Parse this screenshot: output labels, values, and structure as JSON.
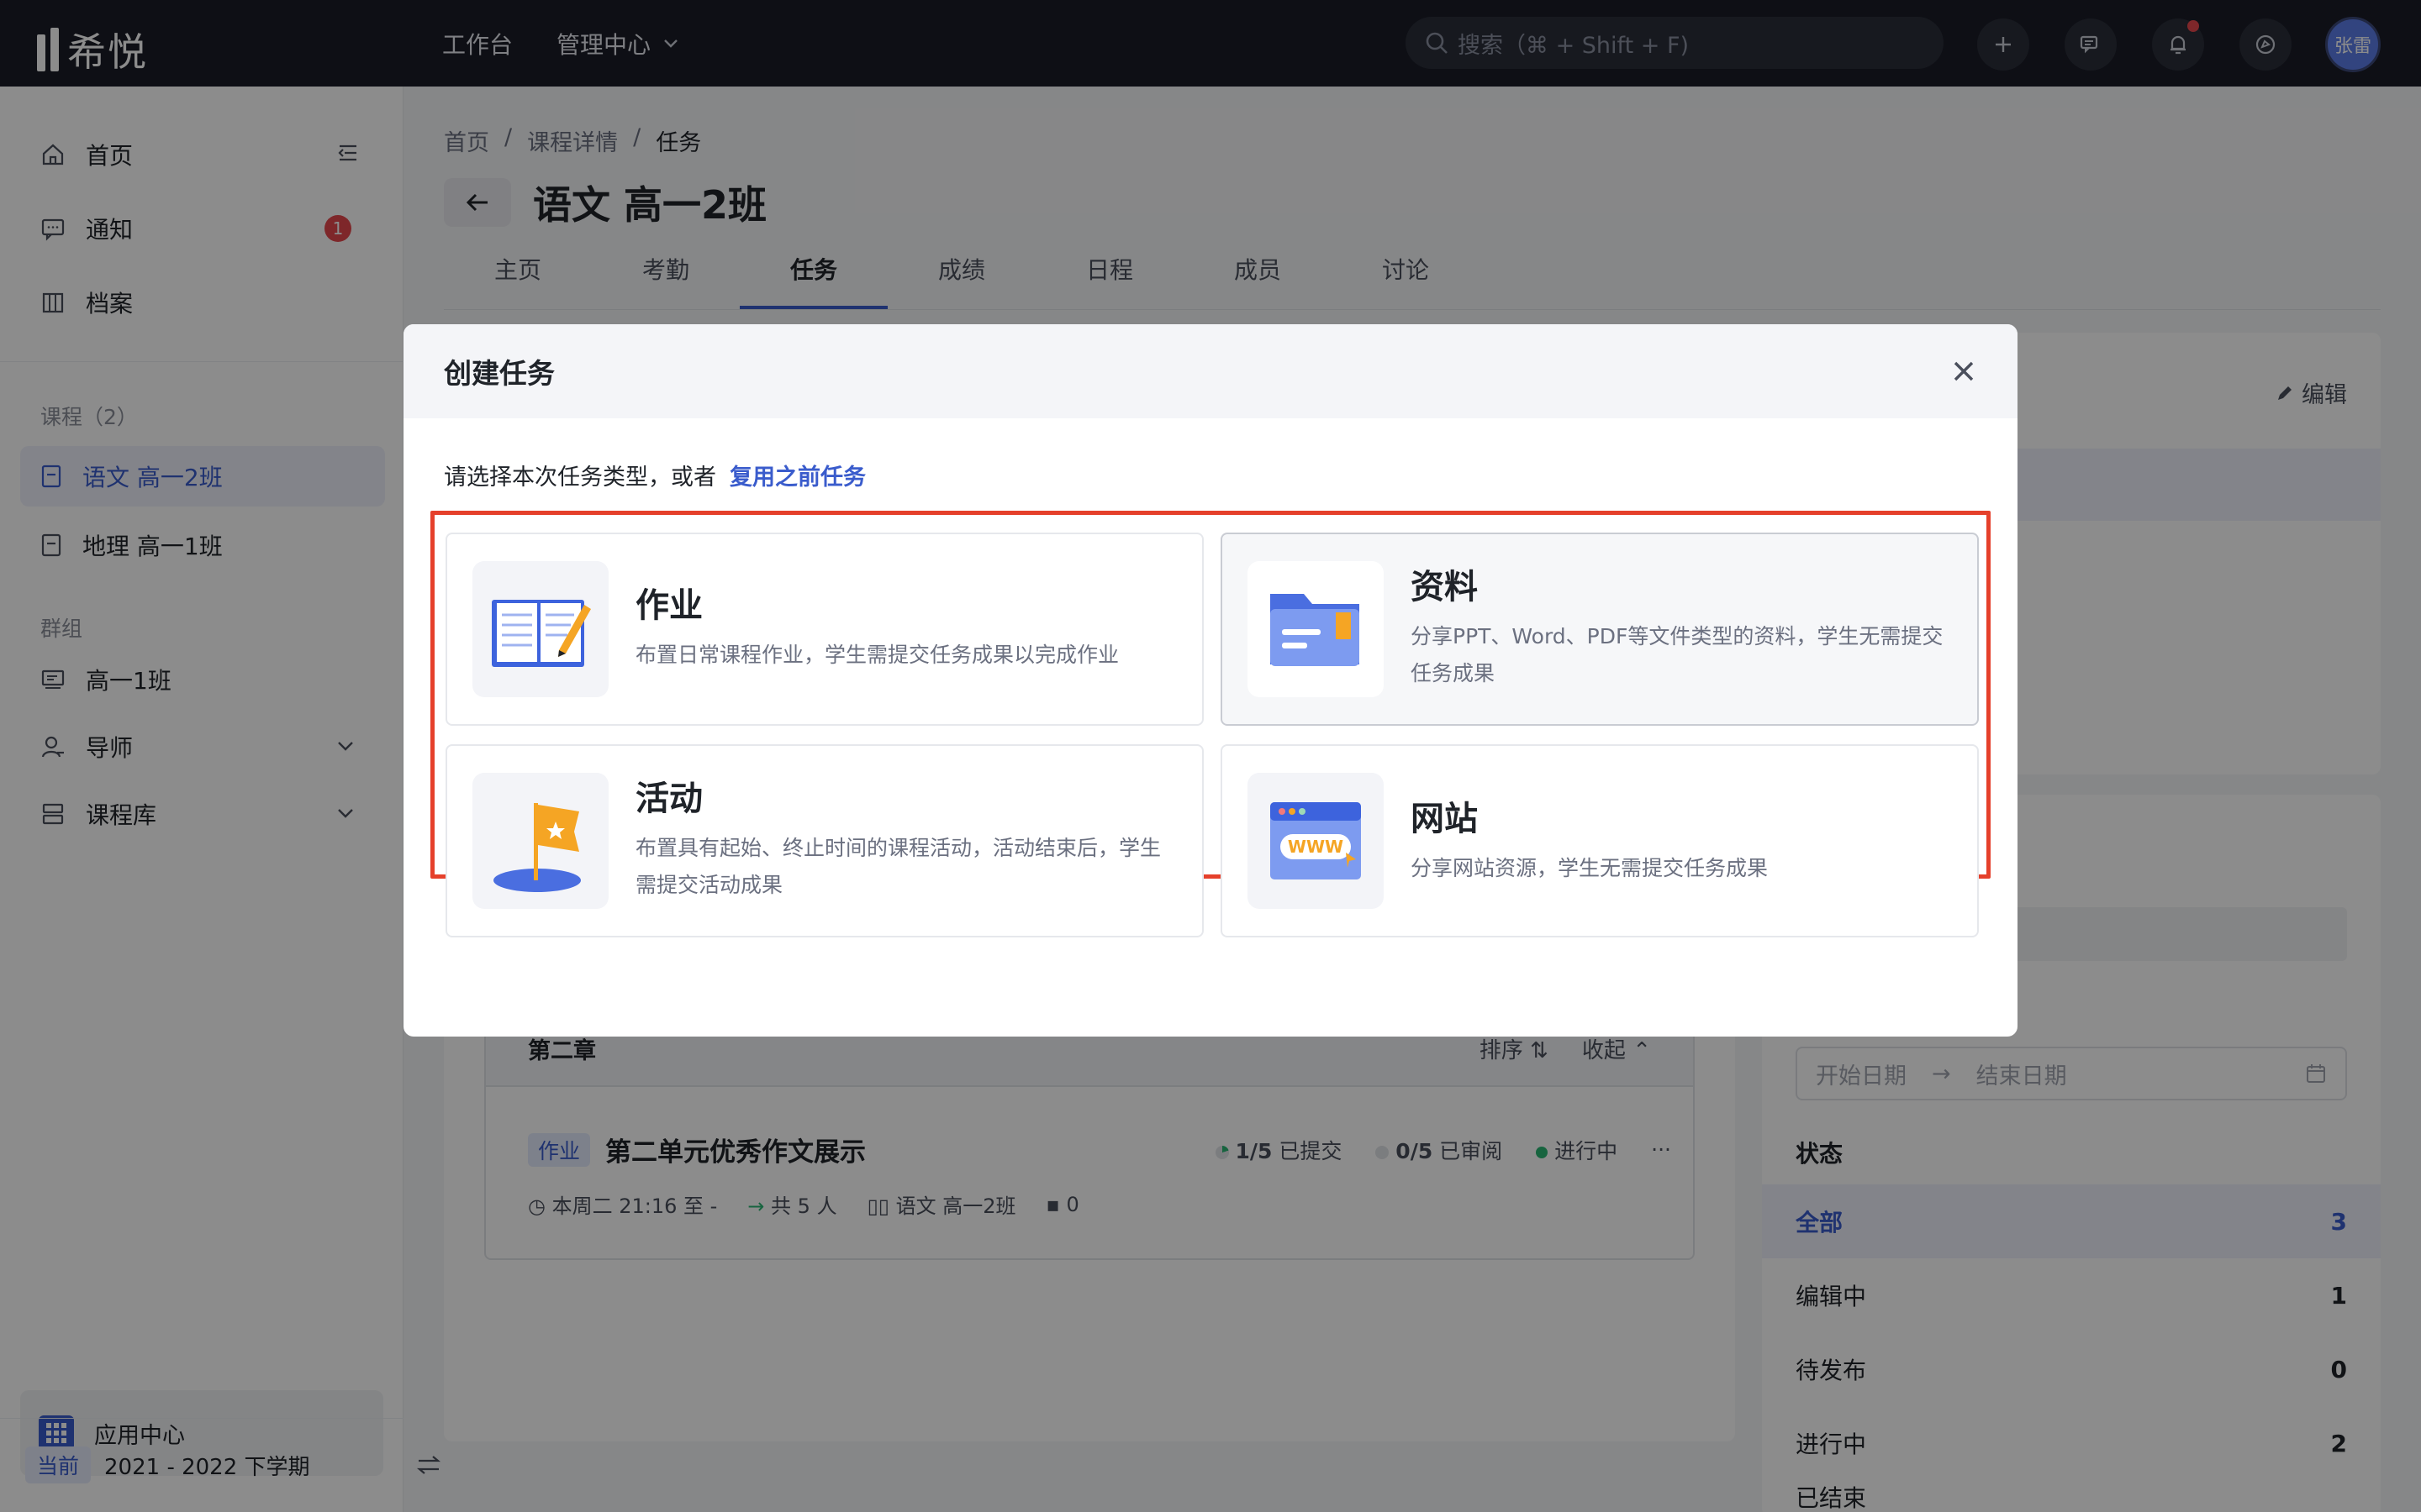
{
  "app": {
    "logo_text": "希悦"
  },
  "topbar": {
    "nav": [
      "工作台",
      "管理中心"
    ],
    "search_placeholder": "搜索（⌘ + Shift + F)",
    "avatar": "张雷"
  },
  "sidebar": {
    "main_items": [
      {
        "label": "首页",
        "icon": "home-icon"
      },
      {
        "label": "通知",
        "icon": "message-icon",
        "badge": "1"
      },
      {
        "label": "档案",
        "icon": "archive-icon"
      }
    ],
    "courses_heading": "课程（2）",
    "courses": [
      "语文 高一2班",
      "地理 高一1班"
    ],
    "groups_heading": "群组",
    "groups": [
      "高一1班",
      "导师",
      "课程库"
    ],
    "app_center": "应用中心",
    "term_label": "当前",
    "term_value": "2021 - 2022 下学期"
  },
  "breadcrumb": [
    "首页",
    "课程详情",
    "任务"
  ],
  "page": {
    "title": "语文 高一2班",
    "tabs": [
      "主页",
      "考勤",
      "任务",
      "成绩",
      "日程",
      "成员",
      "讨论"
    ],
    "active_tab": "任务"
  },
  "task_list": {
    "section": "第二章",
    "sort_label": "排序",
    "collapse_label": "收起",
    "task": {
      "type_tag": "作业",
      "title": "第二单元优秀作文展示",
      "submitted": "1/5",
      "submitted_label": "已提交",
      "reviewed": "0/5",
      "reviewed_label": "已审阅",
      "status": "进行中",
      "time": "本周二 21:16 至 -",
      "people": "共 5 人",
      "class": "语文 高一2班",
      "comments": "0"
    }
  },
  "right_panel": {
    "edit_label": "编辑",
    "date_start": "开始日期",
    "date_end": "结束日期",
    "status_heading": "状态",
    "statuses": [
      {
        "label": "全部",
        "count": "3"
      },
      {
        "label": "编辑中",
        "count": "1"
      },
      {
        "label": "待发布",
        "count": "0"
      },
      {
        "label": "进行中",
        "count": "2"
      },
      {
        "label": "已结束",
        "count": ""
      }
    ]
  },
  "modal": {
    "title": "创建任务",
    "subtitle": "请选择本次任务类型，或者",
    "reuse_link": "复用之前任务",
    "cards": [
      {
        "title": "作业",
        "desc": "布置日常课程作业，学生需提交任务成果以完成作业",
        "icon": "book-pencil-icon"
      },
      {
        "title": "资料",
        "desc": "分享PPT、Word、PDF等文件类型的资料，学生无需提交任务成果",
        "icon": "folder-icon"
      },
      {
        "title": "活动",
        "desc": "布置具有起始、终止时间的课程活动，活动结束后，学生需提交活动成果",
        "icon": "flag-icon"
      },
      {
        "title": "网站",
        "desc": "分享网站资源，学生无需提交任务成果",
        "icon": "website-icon"
      }
    ]
  },
  "colors": {
    "accent": "#3a5ccc",
    "highlight": "#e5402b",
    "danger": "#e5484d"
  }
}
